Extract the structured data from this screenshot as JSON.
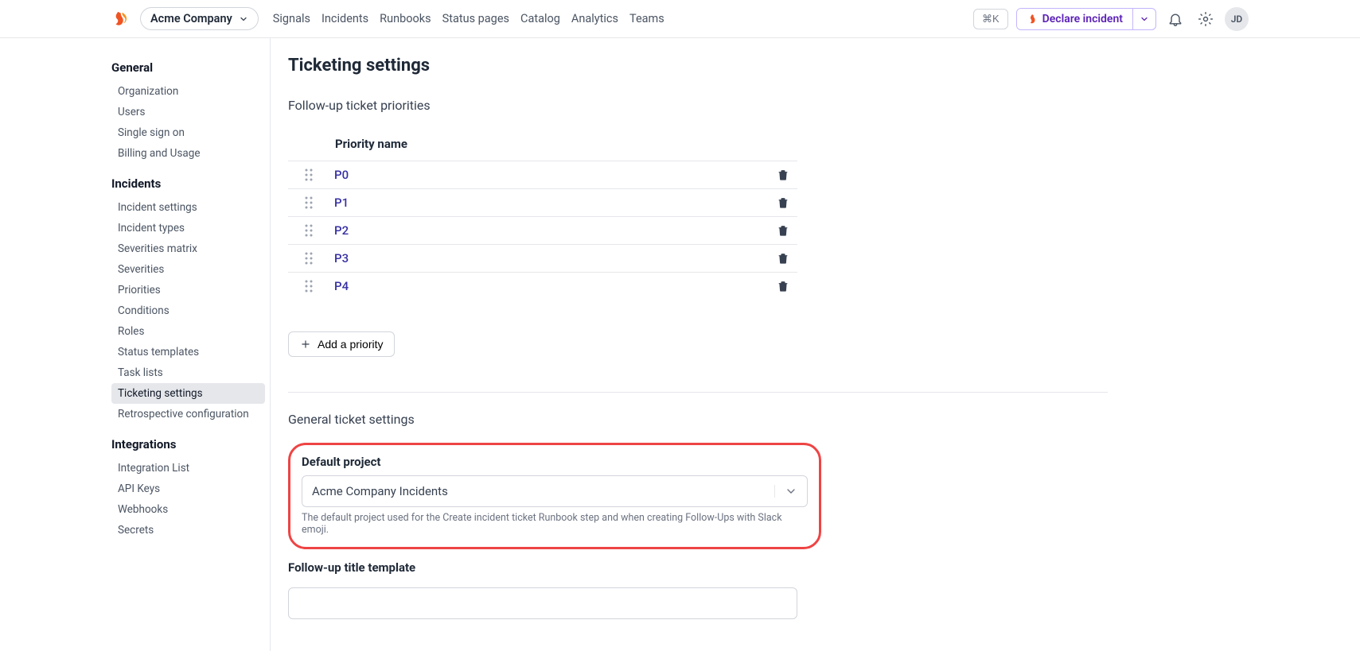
{
  "header": {
    "org_name": "Acme Company",
    "nav": [
      "Signals",
      "Incidents",
      "Runbooks",
      "Status pages",
      "Catalog",
      "Analytics",
      "Teams"
    ],
    "shortcut": "⌘K",
    "declare_label": "Declare incident",
    "avatar_initials": "JD"
  },
  "sidebar": {
    "groups": [
      {
        "title": "General",
        "items": [
          "Organization",
          "Users",
          "Single sign on",
          "Billing and Usage"
        ]
      },
      {
        "title": "Incidents",
        "items": [
          "Incident settings",
          "Incident types",
          "Severities matrix",
          "Severities",
          "Priorities",
          "Conditions",
          "Roles",
          "Status templates",
          "Task lists",
          "Ticketing settings",
          "Retrospective configuration"
        ]
      },
      {
        "title": "Integrations",
        "items": [
          "Integration List",
          "API Keys",
          "Webhooks",
          "Secrets"
        ]
      }
    ],
    "active": "Ticketing settings"
  },
  "main": {
    "title": "Ticketing settings",
    "priorities_section_title": "Follow-up ticket priorities",
    "priority_name_header": "Priority name",
    "priorities": [
      "P0",
      "P1",
      "P2",
      "P3",
      "P4"
    ],
    "add_priority_label": "Add a priority",
    "general_section_title": "General ticket settings",
    "default_project_label": "Default project",
    "default_project_value": "Acme Company Incidents",
    "default_project_help": "The default project used for the Create incident ticket Runbook step and when creating Follow-Ups with Slack emoji.",
    "followup_template_label": "Follow-up title template",
    "followup_template_value": ""
  }
}
